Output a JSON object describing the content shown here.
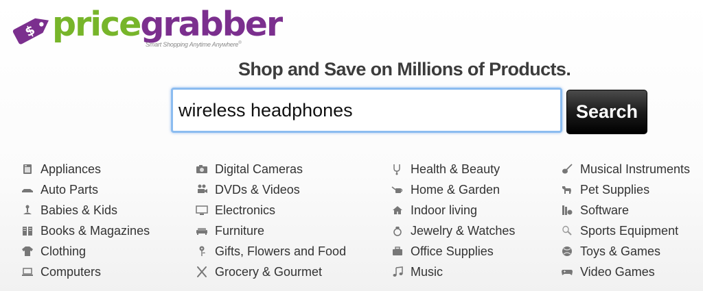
{
  "logo": {
    "word_part1": "price",
    "word_part2": "grabber",
    "tagline": "Smart Shopping Anytime Anywhere",
    "tagline_mark": "®",
    "tag_symbol": "$"
  },
  "headline": "Shop and Save on Millions of Products.",
  "search": {
    "value": "wireless headphones",
    "button_label": "Search"
  },
  "colors": {
    "brand_green": "#77b52a",
    "brand_purple": "#7b2f8e",
    "focus_blue": "#8bbcf0"
  },
  "categories": {
    "col1": [
      {
        "label": "Appliances",
        "icon": "appliance-icon"
      },
      {
        "label": "Auto Parts",
        "icon": "car-icon"
      },
      {
        "label": "Babies & Kids",
        "icon": "baby-icon"
      },
      {
        "label": "Books & Magazines",
        "icon": "book-icon"
      },
      {
        "label": "Clothing",
        "icon": "shirt-icon"
      },
      {
        "label": "Computers",
        "icon": "laptop-icon"
      }
    ],
    "col2": [
      {
        "label": "Digital Cameras",
        "icon": "camera-icon"
      },
      {
        "label": "DVDs & Videos",
        "icon": "film-camera-icon"
      },
      {
        "label": "Electronics",
        "icon": "monitor-icon"
      },
      {
        "label": "Furniture",
        "icon": "sofa-icon"
      },
      {
        "label": "Gifts, Flowers and Food",
        "icon": "flower-icon"
      },
      {
        "label": "Grocery & Gourmet",
        "icon": "utensils-icon"
      }
    ],
    "col3": [
      {
        "label": "Health & Beauty",
        "icon": "stethoscope-icon"
      },
      {
        "label": "Home & Garden",
        "icon": "watering-can-icon"
      },
      {
        "label": "Indoor living",
        "icon": "house-icon"
      },
      {
        "label": "Jewelry & Watches",
        "icon": "ring-icon"
      },
      {
        "label": "Office Supplies",
        "icon": "briefcase-icon"
      },
      {
        "label": "Music",
        "icon": "music-note-icon"
      }
    ],
    "col4": [
      {
        "label": "Musical Instruments",
        "icon": "guitar-icon"
      },
      {
        "label": "Pet Supplies",
        "icon": "dog-icon"
      },
      {
        "label": "Software",
        "icon": "software-icon"
      },
      {
        "label": "Sports Equipment",
        "icon": "tennis-racket-icon"
      },
      {
        "label": "Toys & Games",
        "icon": "ball-icon"
      },
      {
        "label": "Video Games",
        "icon": "gamepad-icon"
      }
    ]
  }
}
